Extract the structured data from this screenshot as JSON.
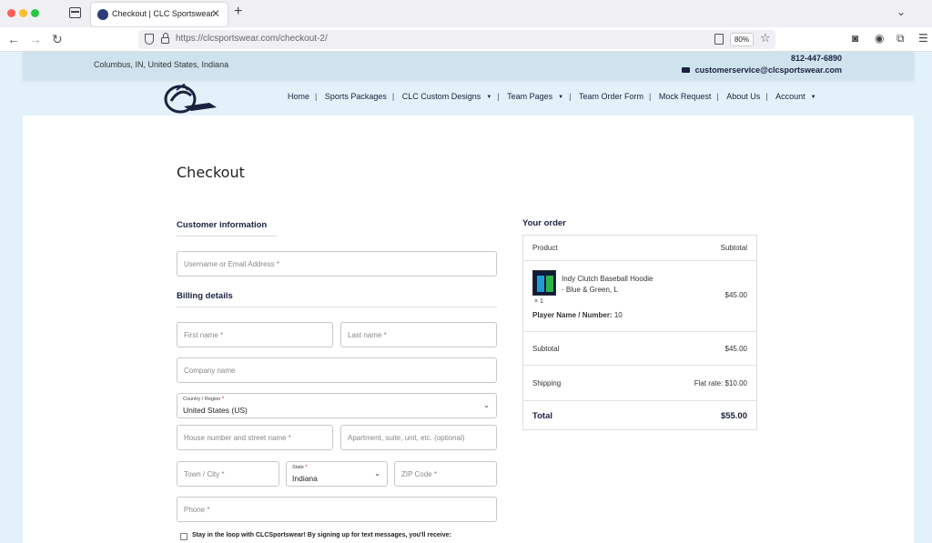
{
  "browser": {
    "tab_title": "Checkout | CLC Sportswear",
    "url_domain": "https://clcsportswear.com",
    "url_path": "/checkout-2/",
    "zoom": "80%"
  },
  "site": {
    "location": "Columbus, IN, United States, Indiana",
    "phone": "812-447-6890",
    "email": "customerservice@clcsportswear.com",
    "nav": [
      {
        "label": "Home"
      },
      {
        "label": "Sports Packages"
      },
      {
        "label": "CLC Custom Designs"
      },
      {
        "label": "Team Pages"
      },
      {
        "label": "Team Order Form"
      },
      {
        "label": "Mock Request"
      },
      {
        "label": "About Us"
      },
      {
        "label": "Account"
      }
    ]
  },
  "checkout": {
    "title": "Checkout",
    "customer_heading": "Customer information",
    "username_placeholder": "Username or Email Address *",
    "billing_heading": "Billing details",
    "first_name_placeholder": "First name *",
    "last_name_placeholder": "Last name *",
    "company_placeholder": "Company name",
    "country_label": "Country / Region",
    "country_value": "United States (US)",
    "street_placeholder": "House number and street name *",
    "apartment_placeholder": "Apartment, suite, unit, etc. (optional)",
    "city_placeholder": "Town / City *",
    "state_label": "State",
    "state_value": "Indiana",
    "zip_placeholder": "ZIP Code *",
    "phone_placeholder": "Phone *",
    "optin_text": "Stay in the loop with CLCSportswear! By signing up for text messages, you'll receive:"
  },
  "order": {
    "heading": "Your order",
    "col_product": "Product",
    "col_subtotal": "Subtotal",
    "item_name_line1": "Indy Clutch Baseball Hoodie",
    "item_name_line2": "- Blue & Green, L",
    "item_qty": "× 1",
    "item_meta_label": "Player Name / Number:",
    "item_meta_value": "10",
    "item_price": "$45.00",
    "subtotal_label": "Subtotal",
    "subtotal_value": "$45.00",
    "shipping_label": "Shipping",
    "shipping_value": "Flat rate: $10.00",
    "total_label": "Total",
    "total_value": "$55.00"
  }
}
